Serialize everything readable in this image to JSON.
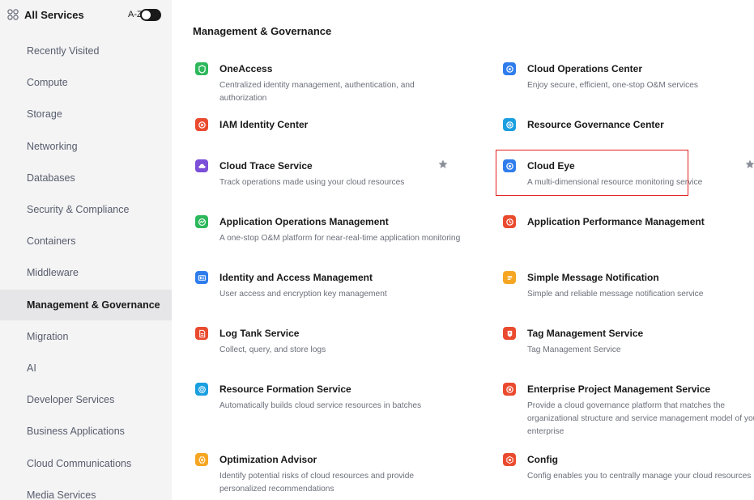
{
  "sidebar": {
    "title": "All Services",
    "az_label": "A-Z",
    "items": [
      {
        "label": "Recently Visited"
      },
      {
        "label": "Compute"
      },
      {
        "label": "Storage"
      },
      {
        "label": "Networking"
      },
      {
        "label": "Databases"
      },
      {
        "label": "Security & Compliance"
      },
      {
        "label": "Containers"
      },
      {
        "label": "Middleware"
      },
      {
        "label": "Management & Governance"
      },
      {
        "label": "Migration"
      },
      {
        "label": "AI"
      },
      {
        "label": "Developer Services"
      },
      {
        "label": "Business Applications"
      },
      {
        "label": "Cloud Communications"
      },
      {
        "label": "Media Services"
      }
    ],
    "active_item": "Management & Governance"
  },
  "main": {
    "section_title": "Management & Governance",
    "services": [
      {
        "name": "OneAccess",
        "desc": "Centralized identity management, authentication, and authorization",
        "icon": "oneaccess-icon",
        "color": "#2eb85c"
      },
      {
        "name": "Cloud Operations Center",
        "desc": "Enjoy secure, efficient, one-stop O&M services",
        "icon": "operations-center-icon",
        "color": "#2f7ded"
      },
      {
        "name": "IAM Identity Center",
        "desc": "",
        "icon": "iam-identity-center-icon",
        "color": "#ea4b2f"
      },
      {
        "name": "Resource Governance Center",
        "desc": "",
        "icon": "governance-center-icon",
        "color": "#1a9fe0"
      },
      {
        "name": "Cloud Trace Service",
        "desc": "Track operations made using your cloud resources",
        "icon": "cloud-trace-icon",
        "color": "#7b4fd8"
      },
      {
        "name": "Cloud Eye",
        "desc": "A multi-dimensional resource monitoring service",
        "icon": "cloud-eye-icon",
        "color": "#2f7ded"
      },
      {
        "name": "Application Operations Management",
        "desc": "A one-stop O&M platform for near-real-time application monitoring",
        "icon": "aom-icon",
        "color": "#2eb85c"
      },
      {
        "name": "Application Performance Management",
        "desc": "",
        "icon": "apm-icon",
        "color": "#ea4b2f"
      },
      {
        "name": "Identity and Access Management",
        "desc": "User access and encryption key management",
        "icon": "iam-icon",
        "color": "#2f7ded"
      },
      {
        "name": "Simple Message Notification",
        "desc": "Simple and reliable message notification service",
        "icon": "smn-icon",
        "color": "#f5a623"
      },
      {
        "name": "Log Tank Service",
        "desc": "Collect, query, and store logs",
        "icon": "lts-icon",
        "color": "#ea4b2f"
      },
      {
        "name": "Tag Management Service",
        "desc": "Tag Management Service",
        "icon": "tag-icon",
        "color": "#ea4b2f"
      },
      {
        "name": "Resource Formation Service",
        "desc": "Automatically builds cloud service resources in batches",
        "icon": "rfs-icon",
        "color": "#1a9fe0"
      },
      {
        "name": "Enterprise Project Management Service",
        "desc": "Provide a cloud governance platform that matches the organizational structure and service management model of your enterprise",
        "icon": "epms-icon",
        "color": "#ea4b2f"
      },
      {
        "name": "Optimization Advisor",
        "desc": "Identify potential risks of cloud resources and provide personalized recommendations",
        "icon": "advisor-icon",
        "color": "#f5a623"
      },
      {
        "name": "Config",
        "desc": "Config enables you to centrally manage your cloud resources",
        "icon": "config-icon",
        "color": "#ea4b2f"
      }
    ]
  },
  "highlighted_service": "Cloud Eye",
  "colors": {
    "sidebar_bg": "#f4f4f5",
    "active_item_bg": "#e6e6e8",
    "highlight_border": "#e21d1d",
    "star": "#8a8e99"
  }
}
